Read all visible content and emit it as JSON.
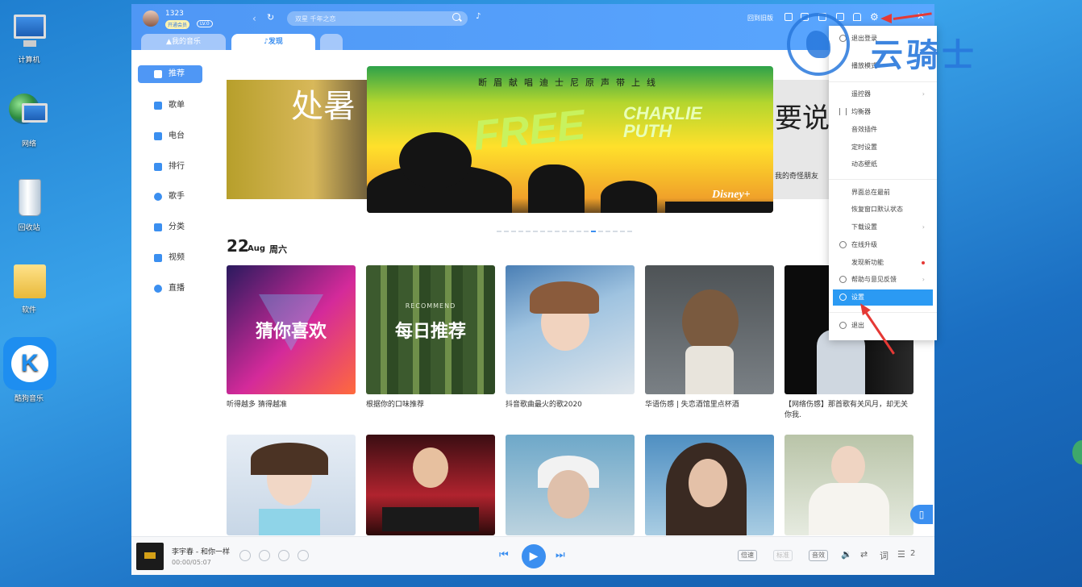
{
  "desktop": {
    "icons": [
      "计算机",
      "网络",
      "回收站",
      "软件",
      "酷狗音乐"
    ]
  },
  "header": {
    "username": "1323",
    "vip_badge": "开通会员",
    "level": "LV.0",
    "search_placeholder": "双星 千年之恋",
    "old_version": "回到旧版"
  },
  "tabs": {
    "my_music": "我的音乐",
    "discover": "发现"
  },
  "sidebar": {
    "items": [
      {
        "label": "推荐",
        "icon": "music-note-icon"
      },
      {
        "label": "歌单",
        "icon": "playlist-icon"
      },
      {
        "label": "电台",
        "icon": "radio-icon"
      },
      {
        "label": "排行",
        "icon": "chart-icon"
      },
      {
        "label": "歌手",
        "icon": "singer-icon"
      },
      {
        "label": "分类",
        "icon": "category-icon"
      },
      {
        "label": "视频",
        "icon": "video-icon"
      },
      {
        "label": "直播",
        "icon": "live-icon"
      }
    ]
  },
  "banner": {
    "left_title": "处暑",
    "main_caption": "断眉献唱迪士尼原声带上线",
    "main_title": "FREE",
    "main_artist": "CHARLIE PUTH",
    "main_brand": "Disney+",
    "right_title": "要说",
    "right_sub": "我的奇怪朋友"
  },
  "date": {
    "day": "22",
    "month": "Aug",
    "weekday": "周六"
  },
  "playlists": [
    {
      "overlay": "猜你喜欢",
      "caption": "听得越多 猜得越准"
    },
    {
      "overlay": "每日推荐",
      "overlay_small": "RECOMMEND",
      "caption": "根据你的口味推荐"
    },
    {
      "overlay": "",
      "caption": "抖音歌曲最火的歌2020"
    },
    {
      "overlay": "",
      "caption": "华语伤感 | 失恋酒馆里点杯酒"
    },
    {
      "overlay": "",
      "caption": "【网络伤感】那首歌有关风月，却无关你我."
    }
  ],
  "player": {
    "song": "李宇春 - 和你一样",
    "time": "00:00/05:07",
    "speed_label": "倍速",
    "quality_label": "标准",
    "effect_label": "音效",
    "lyrics_label": "词",
    "queue_count": "2"
  },
  "menu": {
    "items": [
      {
        "label": "退出登录",
        "icon": "info-icon"
      },
      {
        "label": "播放模式",
        "arrow": true
      },
      {
        "label": "遥控器",
        "arrow": true
      },
      {
        "label": "均衡器",
        "icon": "equalizer-icon"
      },
      {
        "label": "音效插件"
      },
      {
        "label": "定时设置"
      },
      {
        "label": "动态壁纸"
      },
      {
        "label": "界面总在最前"
      },
      {
        "label": "恢复窗口默认状态"
      },
      {
        "label": "下载设置",
        "arrow": true
      },
      {
        "label": "在线升级",
        "icon": "upgrade-icon"
      },
      {
        "label": "发现新功能",
        "dot": true
      },
      {
        "label": "帮助与意见反馈",
        "icon": "help-icon",
        "arrow": true
      },
      {
        "label": "设置",
        "icon": "settings-icon",
        "active": true
      },
      {
        "label": "退出",
        "icon": "power-icon"
      }
    ]
  },
  "watermark": {
    "text": "云骑士"
  },
  "colors": {
    "accent": "#3b8ff0",
    "header": "#4f97f5",
    "menu_active": "#2b9af3",
    "annotation": "#e53935"
  }
}
